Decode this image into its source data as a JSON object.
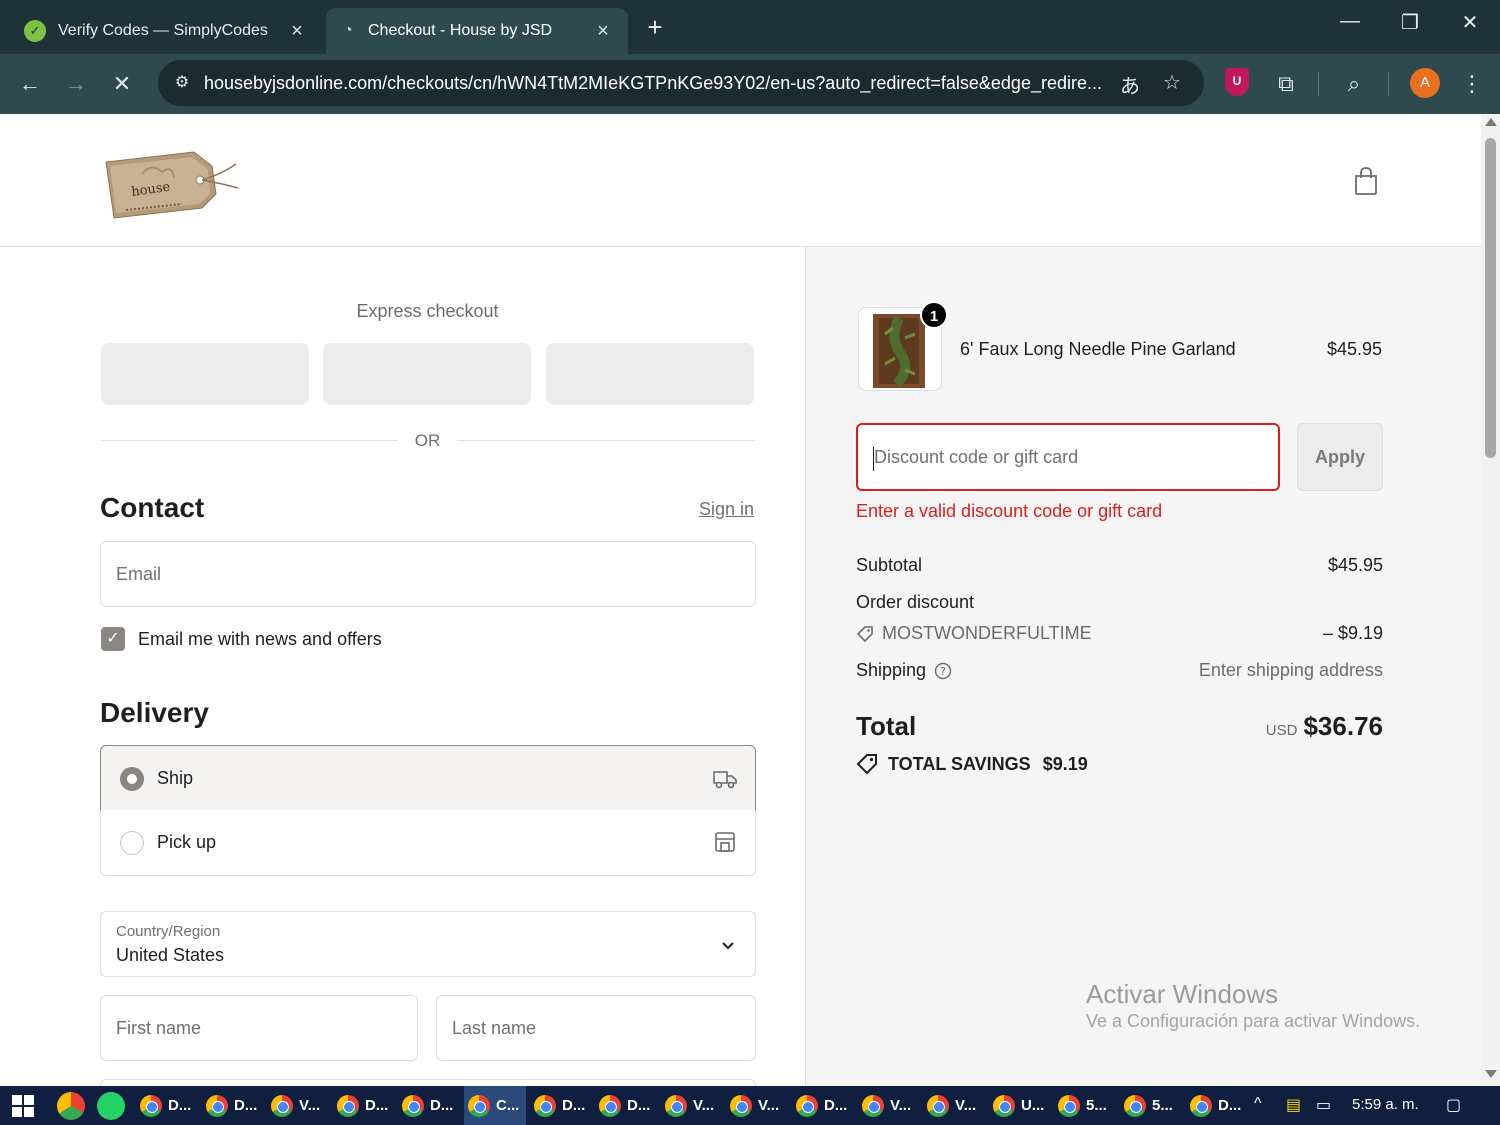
{
  "browser": {
    "tabs": [
      {
        "title": "Verify Codes — SimplyCodes",
        "active": false
      },
      {
        "title": "Checkout - House by JSD",
        "active": true
      }
    ],
    "url": "housebyjsdonline.com/checkouts/cn/hWN4TtM2MIeKGTPnKGe93Y02/en-us?auto_redirect=false&edge_redire...",
    "avatar_letter": "A",
    "shield_letter": "U"
  },
  "checkout": {
    "logo_text": "house",
    "express_title": "Express checkout",
    "or_text": "OR",
    "contact_heading": "Contact",
    "sign_in": "Sign in",
    "email_placeholder": "Email",
    "news_label": "Email me with news and offers",
    "news_checked": true,
    "delivery_heading": "Delivery",
    "options": [
      {
        "label": "Ship",
        "selected": true,
        "icon": "truck-icon"
      },
      {
        "label": "Pick up",
        "selected": false,
        "icon": "store-icon"
      }
    ],
    "country_label": "Country/Region",
    "country_value": "United States",
    "first_name_placeholder": "First name",
    "last_name_placeholder": "Last name"
  },
  "summary": {
    "product_name": "6' Faux Long Needle Pine Garland",
    "product_price": "$45.95",
    "quantity": "1",
    "discount_placeholder": "Discount code or gift card",
    "apply_label": "Apply",
    "error": "Enter a valid discount code or gift card",
    "subtotal_label": "Subtotal",
    "subtotal_value": "$45.95",
    "order_discount_label": "Order discount",
    "discount_code": "MOSTWONDERFULTIME",
    "discount_value": "– $9.19",
    "shipping_label": "Shipping",
    "shipping_value": "Enter shipping address",
    "total_label": "Total",
    "currency": "USD",
    "total_value": "$36.76",
    "savings_label": "TOTAL SAVINGS",
    "savings_value": "$9.19"
  },
  "watermark": {
    "line1": "Activar Windows",
    "line2": "Ve a Configuración para activar Windows."
  },
  "taskbar": {
    "items": [
      "D...",
      "D...",
      "V...",
      "D...",
      "D...",
      "C...",
      "D...",
      "D...",
      "V...",
      "V...",
      "D...",
      "V...",
      "V...",
      "U...",
      "5...",
      "5...",
      "D..."
    ],
    "active_index": 5,
    "clock": "5:59 a. m."
  },
  "colors": {
    "error": "#dd1d1d",
    "tab_bar": "#1e3337",
    "toolbar": "#2f4a4f",
    "taskbar": "#101f3f"
  }
}
